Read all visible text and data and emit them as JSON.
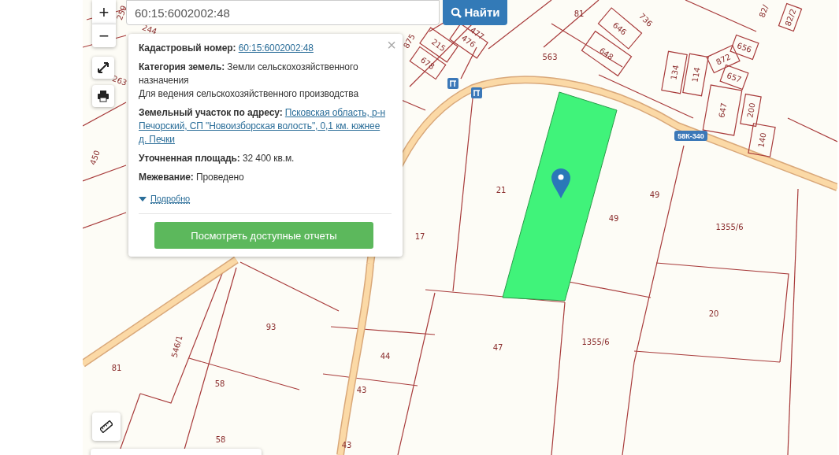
{
  "search": {
    "value": "60:15:6002002:48",
    "button": "Найти"
  },
  "map_controls": {
    "zoom_in": "+",
    "zoom_out": "−"
  },
  "popup": {
    "fields": [
      {
        "kind": "link",
        "label": "Кадастровый номер:",
        "value": "60:15:6002002:48"
      },
      {
        "kind": "text",
        "label": "Категория земель:",
        "value": [
          "Земли сельскохозяйственного",
          "назначения"
        ],
        "note": "Для ведения сельскохозяйственного производства"
      },
      {
        "kind": "link",
        "label": "Земельный участок по адресу:",
        "value": [
          "Псковская область, р-н",
          "Печорский, СП \"Новоизборская волость\", 0,1 км. южнее",
          "д. Печки"
        ]
      },
      {
        "kind": "text",
        "label": "Уточненная площадь:",
        "value": "32 400 кв.м."
      },
      {
        "kind": "text",
        "label": "Межевание:",
        "value": "Проведено"
      }
    ],
    "close": "×",
    "details": {
      "label": "Подробно",
      "expanded": false
    },
    "button": "Посмотреть доступные отчеты"
  },
  "map": {
    "road_sign": "58К-340",
    "parcel_labels": [
      "259",
      "244",
      "263",
      "450",
      "875",
      "215",
      "476",
      "477",
      "678",
      "81",
      "736",
      "646",
      "648",
      "563",
      "134",
      "114",
      "872",
      "656",
      "657",
      "82/",
      "82/2",
      "647",
      "200",
      "140",
      "21",
      "49",
      "49",
      "17",
      "1355/6",
      "20",
      "1355/6",
      "93",
      "546/1",
      "81",
      "58",
      "58",
      "44",
      "43",
      "43",
      "47"
    ]
  }
}
